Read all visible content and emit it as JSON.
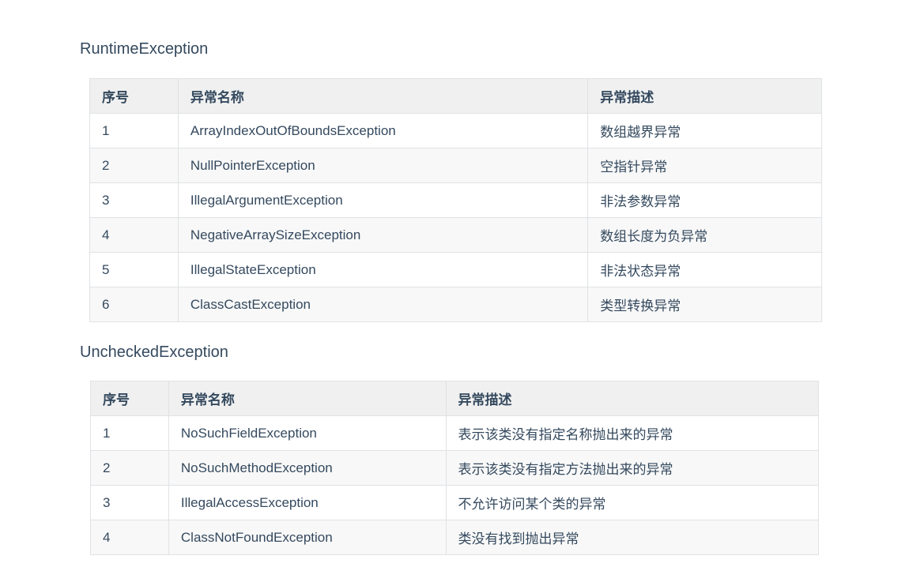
{
  "sections": {
    "runtime": {
      "title": "RuntimeException",
      "headers": [
        "序号",
        "异常名称",
        "异常描述"
      ],
      "rows": [
        [
          "1",
          "ArrayIndexOutOfBoundsException",
          "数组越界异常"
        ],
        [
          "2",
          "NullPointerException",
          "空指针异常"
        ],
        [
          "3",
          "IllegalArgumentException",
          "非法参数异常"
        ],
        [
          "4",
          "NegativeArraySizeException",
          "数组长度为负异常"
        ],
        [
          "5",
          "IllegalStateException",
          "非法状态异常"
        ],
        [
          "6",
          "ClassCastException",
          "类型转换异常"
        ]
      ]
    },
    "unchecked": {
      "title": "UncheckedException",
      "headers": [
        "序号",
        "异常名称",
        "异常描述"
      ],
      "rows": [
        [
          "1",
          "NoSuchFieldException",
          "表示该类没有指定名称抛出来的异常"
        ],
        [
          "2",
          "NoSuchMethodException",
          "表示该类没有指定方法抛出来的异常"
        ],
        [
          "3",
          "IllegalAccessException",
          "不允许访问某个类的异常"
        ],
        [
          "4",
          "ClassNotFoundException",
          "类没有找到抛出异常"
        ]
      ]
    }
  },
  "colors": {
    "text": "#34495e",
    "header_bg": "#f0f0f0",
    "stripe_bg": "#f8f8f8",
    "border": "#dfe2e5"
  }
}
